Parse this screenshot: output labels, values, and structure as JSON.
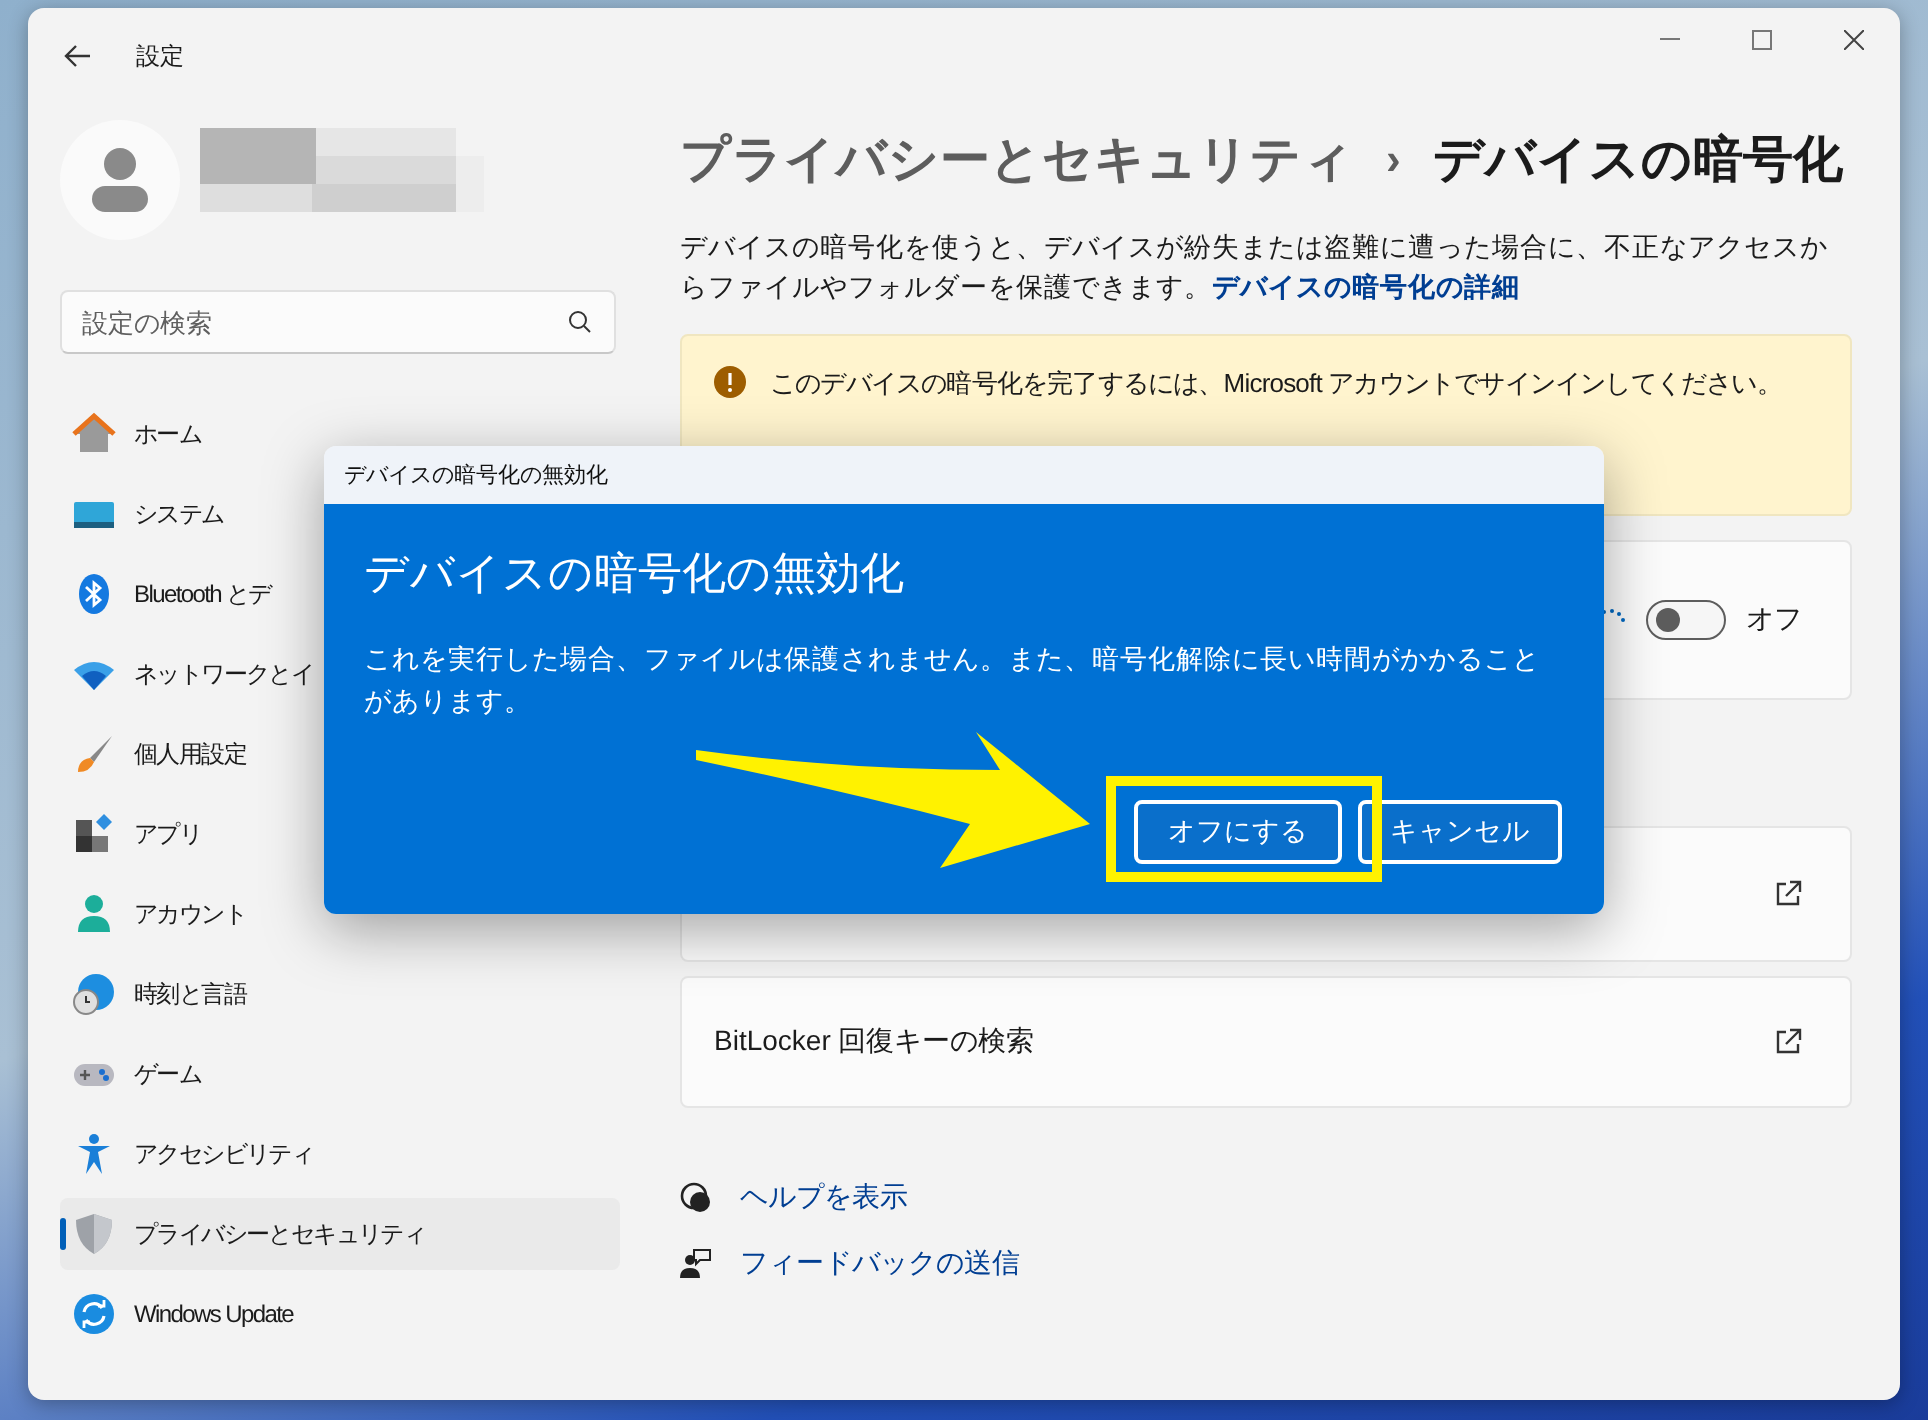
{
  "window": {
    "title": "設定"
  },
  "search": {
    "placeholder": "設定の検索"
  },
  "nav": [
    {
      "label": "ホーム",
      "selected": false
    },
    {
      "label": "システム",
      "selected": false
    },
    {
      "label": "Bluetooth とデ",
      "selected": false
    },
    {
      "label": "ネットワークとイ",
      "selected": false
    },
    {
      "label": "個人用設定",
      "selected": false
    },
    {
      "label": "アプリ",
      "selected": false
    },
    {
      "label": "アカウント",
      "selected": false
    },
    {
      "label": "時刻と言語",
      "selected": false
    },
    {
      "label": "ゲーム",
      "selected": false
    },
    {
      "label": "アクセシビリティ",
      "selected": false
    },
    {
      "label": "プライバシーとセキュリティ",
      "selected": true
    },
    {
      "label": "Windows Update",
      "selected": false
    }
  ],
  "breadcrumb": {
    "parent": "プライバシーとセキュリティ",
    "separator": "›",
    "current": "デバイスの暗号化"
  },
  "description": {
    "text": "デバイスの暗号化を使うと、デバイスが紛失または盗難に遭った場合に、不正なアクセスからファイルやフォルダーを保護できます。",
    "link": "デバイスの暗号化の詳細"
  },
  "warning": {
    "message": "このデバイスの暗号化を完了するには、Microsoft アカウントでサインインしてください。"
  },
  "encryption_toggle": {
    "on": false,
    "state_label": "オフ"
  },
  "link_cards": [
    {
      "label": "BitLocker 回復キーの検索"
    }
  ],
  "help_links": [
    "ヘルプを表示",
    "フィードバックの送信"
  ],
  "dialog": {
    "title": "デバイスの暗号化の無効化",
    "heading": "デバイスの暗号化の無効化",
    "message": "これを実行した場合、ファイルは保護されません。また、暗号化解除に長い時間がかかることがあります。",
    "buttons": [
      "オフにする",
      "キャンセル"
    ]
  }
}
